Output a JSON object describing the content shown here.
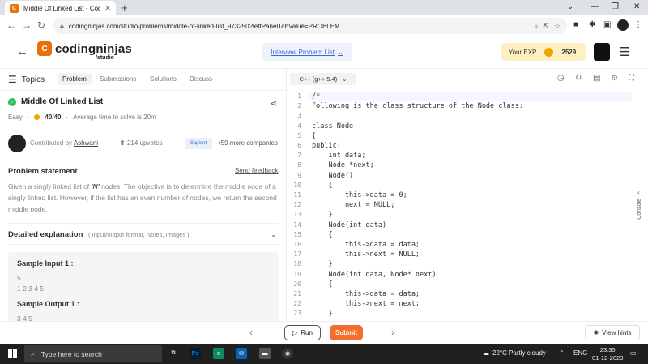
{
  "browser": {
    "tab_title": "Middle Of Linked List - Coding N",
    "url": "codingninjas.com/studio/problems/middle-of-linked-list_973250?leftPanelTabValue=PROBLEM"
  },
  "header": {
    "logo_text": "codingninjas",
    "logo_sub": "/studio",
    "interview_list": "Interview Problem List",
    "exp_label": "Your EXP",
    "exp_value": "2529"
  },
  "tabs": {
    "topics": "Topics",
    "problem": "Problem",
    "submissions": "Submissions",
    "solutions": "Solutions",
    "discuss": "Discuss"
  },
  "problem": {
    "title": "Middle Of Linked List",
    "difficulty": "Easy",
    "score": "40/40",
    "avg_time": "Average time to solve is 20m",
    "contributed_prefix": "Contributed by",
    "contributor": "Ashwani",
    "upvotes": "214 upvotes",
    "companies_more": "+59 more companies",
    "company_badge": "Sapient",
    "statement_heading": "Problem statement",
    "send_feedback": "Send feedback",
    "statement_pre": "Given a singly linked list of ",
    "statement_n": "'N'",
    "statement_post": " nodes. The objective is to determine the middle node of a singly linked list. However, if the list has an even number of nodes, we return the second middle node.",
    "detailed_heading": "Detailed explanation",
    "detailed_sub": "( Input/output format, Notes, Images )",
    "sample_input_heading": "Sample Input 1 :",
    "sample_input_line1": "5",
    "sample_input_line2": "1 2 3 4 5",
    "sample_output_heading": "Sample Output 1 :",
    "sample_output_line1": "3 4 5"
  },
  "editor": {
    "language": "C++ (g++ 5.4)",
    "console_label": "Console",
    "lines": [
      {
        "n": "1",
        "code": "/*"
      },
      {
        "n": "2",
        "code": "Following is the class structure of the Node class:"
      },
      {
        "n": "3",
        "code": ""
      },
      {
        "n": "4",
        "code": "class Node"
      },
      {
        "n": "5",
        "code": "{"
      },
      {
        "n": "6",
        "code": "public:"
      },
      {
        "n": "7",
        "code": "    int data;"
      },
      {
        "n": "8",
        "code": "    Node *next;"
      },
      {
        "n": "9",
        "code": "    Node()"
      },
      {
        "n": "10",
        "code": "    {"
      },
      {
        "n": "11",
        "code": "        this->data = 0;"
      },
      {
        "n": "12",
        "code": "        next = NULL;"
      },
      {
        "n": "13",
        "code": "    }"
      },
      {
        "n": "14",
        "code": "    Node(int data)"
      },
      {
        "n": "15",
        "code": "    {"
      },
      {
        "n": "16",
        "code": "        this->data = data;"
      },
      {
        "n": "17",
        "code": "        this->next = NULL;"
      },
      {
        "n": "18",
        "code": "    }"
      },
      {
        "n": "19",
        "code": "    Node(int data, Node* next)"
      },
      {
        "n": "20",
        "code": "    {"
      },
      {
        "n": "21",
        "code": "        this->data = data;"
      },
      {
        "n": "22",
        "code": "        this->next = next;"
      },
      {
        "n": "23",
        "code": "    }"
      }
    ]
  },
  "actions": {
    "run": "Run",
    "submit": "Submit",
    "view_hints": "View hints"
  },
  "taskbar": {
    "search_placeholder": "Type here to search",
    "weather": "22°C  Partly cloudy",
    "lang": "ENG",
    "time": "23:35",
    "date": "01-12-2023"
  }
}
